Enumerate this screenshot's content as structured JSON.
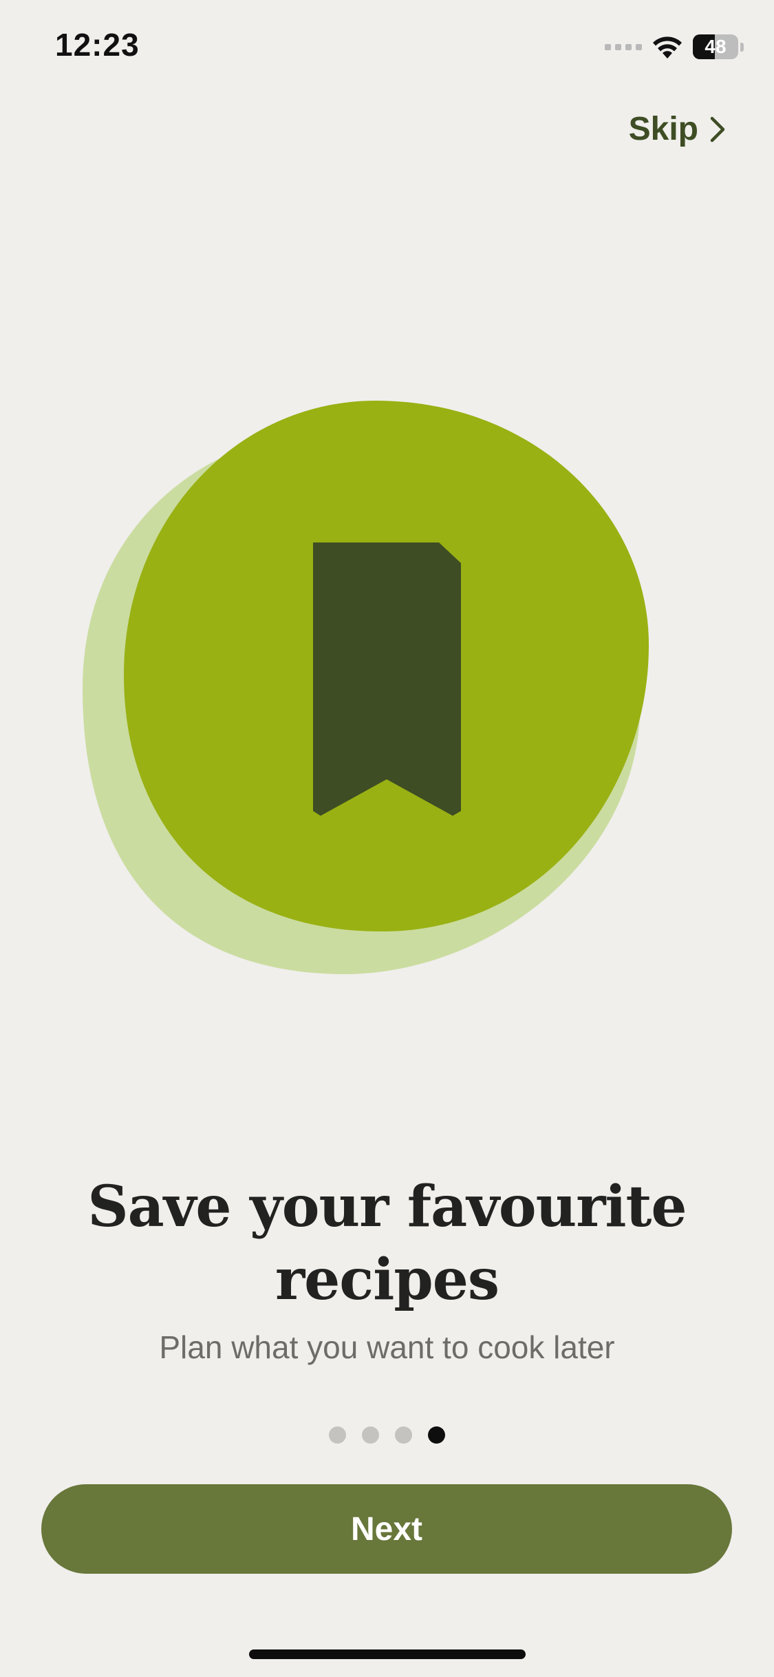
{
  "status_bar": {
    "time": "12:23",
    "battery_level": "48",
    "battery_fraction": 0.48,
    "icons": [
      "cellular-signal-icon",
      "wifi-icon",
      "battery-icon"
    ]
  },
  "header": {
    "skip_label": "Skip",
    "skip_icon": "chevron-right-icon"
  },
  "illustration": {
    "icon": "bookmark-icon",
    "colors": {
      "back_blob": "#cbdca0",
      "front_blob": "#99b113",
      "bookmark": "#3e4d24"
    }
  },
  "onboarding": {
    "title_line1": "Save your favourite",
    "title_line2": "recipes",
    "subtitle": "Plan what you want to cook later",
    "page_count": 4,
    "current_page": 4
  },
  "footer": {
    "next_label": "Next"
  },
  "colors": {
    "background": "#f0efec",
    "accent": "#68773a",
    "skip_text": "#3e4d24"
  }
}
